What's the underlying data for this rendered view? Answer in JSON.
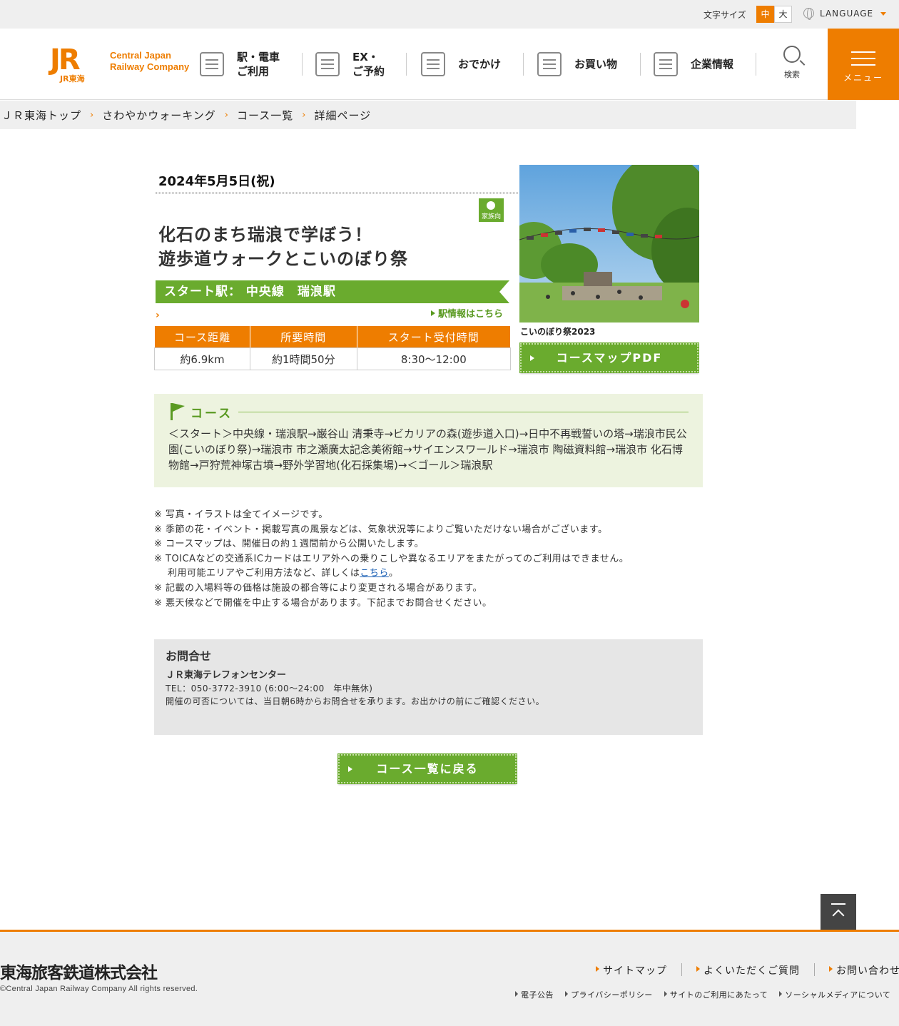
{
  "util": {
    "font_size_label": "文字サイズ",
    "font_size_mid": "中",
    "font_size_large": "大",
    "language": "LANGUAGE"
  },
  "header": {
    "logo_mark": "JR",
    "logo_sub": "JR東海",
    "logo_en_line1": "Central Japan",
    "logo_en_line2": "Railway Company",
    "nav": [
      {
        "line1": "駅・電車",
        "line2": "ご利用",
        "icon": "train-icon"
      },
      {
        "line1": "EX・",
        "line2": "ご予約",
        "icon": "ticket-icon"
      },
      {
        "line1": "おでかけ",
        "line2": "",
        "icon": "suitcase-icon"
      },
      {
        "line1": "お買い物",
        "line2": "",
        "icon": "shopping-bag-icon"
      },
      {
        "line1": "企業情報",
        "line2": "",
        "icon": "building-icon"
      }
    ],
    "search_label": "検索",
    "menu_label": "メニュー"
  },
  "breadcrumb": [
    "ＪＲ東海トップ",
    "さわやかウォーキング",
    "コース一覧",
    "詳細ページ"
  ],
  "event": {
    "date": "2024年5月5日(祝)",
    "family_badge": "家族向",
    "title_line1": "化石のまち瑞浪で学ぼう！",
    "title_line2": "遊歩道ウォークとこいのぼり祭",
    "start_station": "スタート駅：  中央線　瑞浪駅",
    "station_link": "駅情報はこちら",
    "table_headers": [
      "コース距離",
      "所要時間",
      "スタート受付時間"
    ],
    "table_values": [
      "約6.9km",
      "約1時間50分",
      "8:30～12:00"
    ],
    "photo_caption": "こいのぼり祭2023",
    "pdf_button": "コースマップPDF"
  },
  "course": {
    "heading": "コース",
    "text": "＜スタート＞中央線・瑞浪駅→巌谷山 清秉寺→ビカリアの森(遊歩道入口)→日中不再戦誓いの塔→瑞浪市民公園(こいのぼり祭)→瑞浪市 市之瀬廣太記念美術館→サイエンスワールド→瑞浪市 陶磁資料館→瑞浪市 化石博物館→戸狩荒神塚古墳→野外学習地(化石採集場)→＜ゴール＞瑞浪駅"
  },
  "notes": {
    "n1": "※ 写真・イラストは全てイメージです。",
    "n2": "※ 季節の花・イベント・掲載写真の風景などは、気象状況等によりご覧いただけない場合がございます。",
    "n3": "※ コースマップは、開催日の約１週間前から公開いたします。",
    "n4": "※ TOICAなどの交通系ICカードはエリア外への乗りこしや異なるエリアをまたがってのご利用はできません。",
    "n4_cont": "利用可能エリアやご利用方法など、詳しくは",
    "n4_link": "こちら",
    "n4_end": "。",
    "n5": "※ 記載の入場料等の価格は施設の都合等により変更される場合があります。",
    "n6": "※ 悪天候などで開催を中止する場合があります。下記までお問合せください。"
  },
  "contact": {
    "title": "お問合せ",
    "org": "ＪＲ東海テレフォンセンター",
    "tel": "TEL：050-3772-3910 (6:00～24:00　年中無休)",
    "note": "開催の可否については、当日朝6時からお問合せを承ります。お出かけの前にご確認ください。"
  },
  "back_button": "コース一覧に戻る",
  "footer": {
    "company": "東海旅客鉄道株式会社",
    "copyright": "©Central Japan Railway Company All rights reserved.",
    "links_main": [
      "サイトマップ",
      "よくいただくご質問",
      "お問い合わせ"
    ],
    "links_sub": [
      "電子公告",
      "プライバシーポリシー",
      "サイトのご利用にあたって",
      "ソーシャルメディアについて"
    ]
  },
  "colors": {
    "brand_orange": "#ee7d00",
    "accent_green": "#6aab2e",
    "course_bg": "#edf3df"
  }
}
